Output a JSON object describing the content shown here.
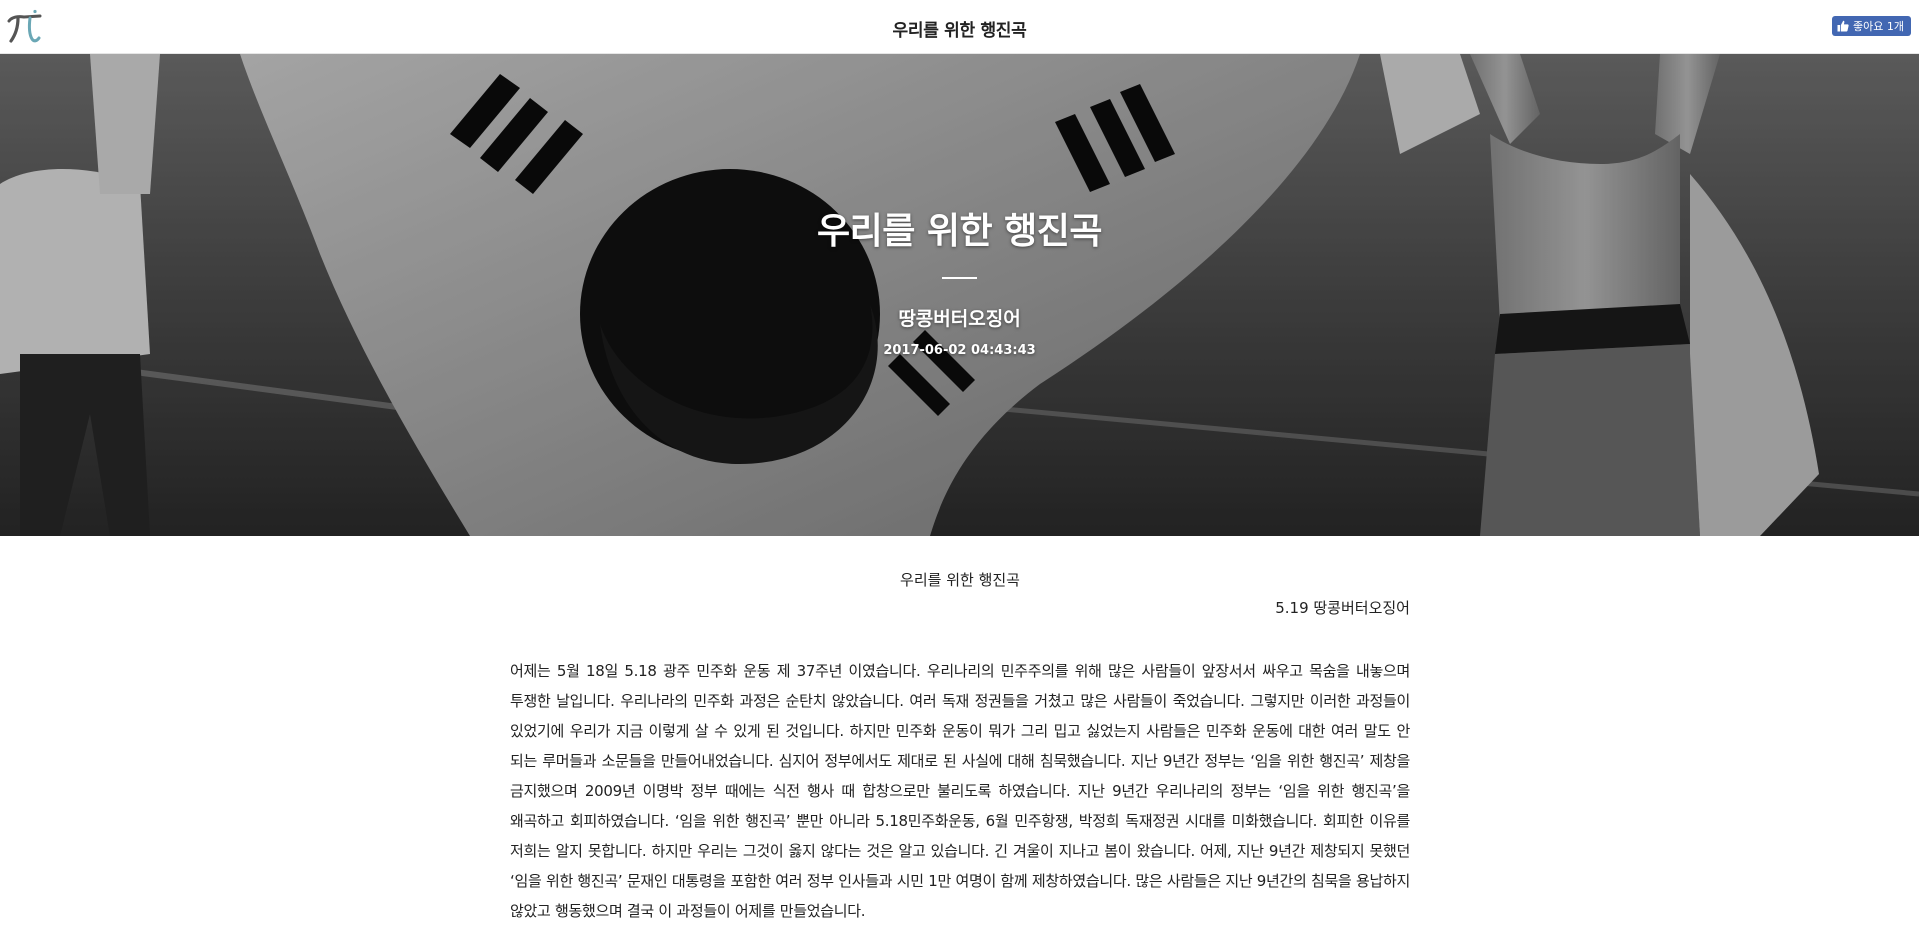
{
  "topbar": {
    "logo_icon": "pi-logo-icon",
    "title": "우리를 위한 행진곡",
    "like_button": {
      "icon": "thumbs-up-icon",
      "label": "좋아요 1개",
      "color": "#4267b2"
    }
  },
  "hero": {
    "title": "우리를 위한 행진곡",
    "author": "땅콩버터오징어",
    "date": "2017-06-02 04:43:43"
  },
  "article": {
    "title": "우리를 위한 행진곡",
    "byline": "5.19 땅콩버터오징어",
    "body": " 어제는 5월 18일 5.18 광주 민주화 운동 제 37주년 이였습니다. 우리나리의 민주주의를 위해 많은 사람들이 앞장서서 싸우고 목숨을 내놓으며 투쟁한 날입니다. 우리나라의 민주화 과정은 순탄치 않았습니다. 여러 독재 정권들을 거쳤고 많은 사람들이 죽었습니다. 그렇지만 이러한 과정들이 있었기에 우리가 지금 이렇게 살 수 있게 된 것입니다. 하지만 민주화 운동이 뭐가 그리 밉고 싫었는지 사람들은 민주화 운동에 대한 여러 말도 안 되는 루머들과 소문들을 만들어내었습니다. 심지어 정부에서도 제대로 된 사실에 대해 침묵했습니다. 지난 9년간 정부는 ‘임을 위한 행진곡’ 제창을 금지했으며 2009년 이명박 정부 때에는 식전 행사 때 합창으로만 불리도록 하였습니다. 지난 9년간 우리나리의 정부는 ‘임을 위한 행진곡’을 왜곡하고 회피하였습니다. ‘임을 위한 행진곡’ 뿐만 아니라 5.18민주화운동, 6월 민주항쟁, 박정희 독재정권 시대를 미화했습니다. 회피한 이유를 저희는 알지 못합니다. 하지만 우리는 그것이 옳지 않다는 것은 알고 있습니다. 긴 겨울이 지나고 봄이 왔습니다. 어제, 지난 9년간 제창되지 못했던 ‘임을 위한 행진곡’ 문재인 대통령을 포함한 여러 정부 인사들과 시민 1만 여명이 함께 제창하였습니다. 많은 사람들은 지난 9년간의 침묵을 용납하지 않았고 행동했으며 결국 이 과정들이 어제를 만들었습니다."
  }
}
